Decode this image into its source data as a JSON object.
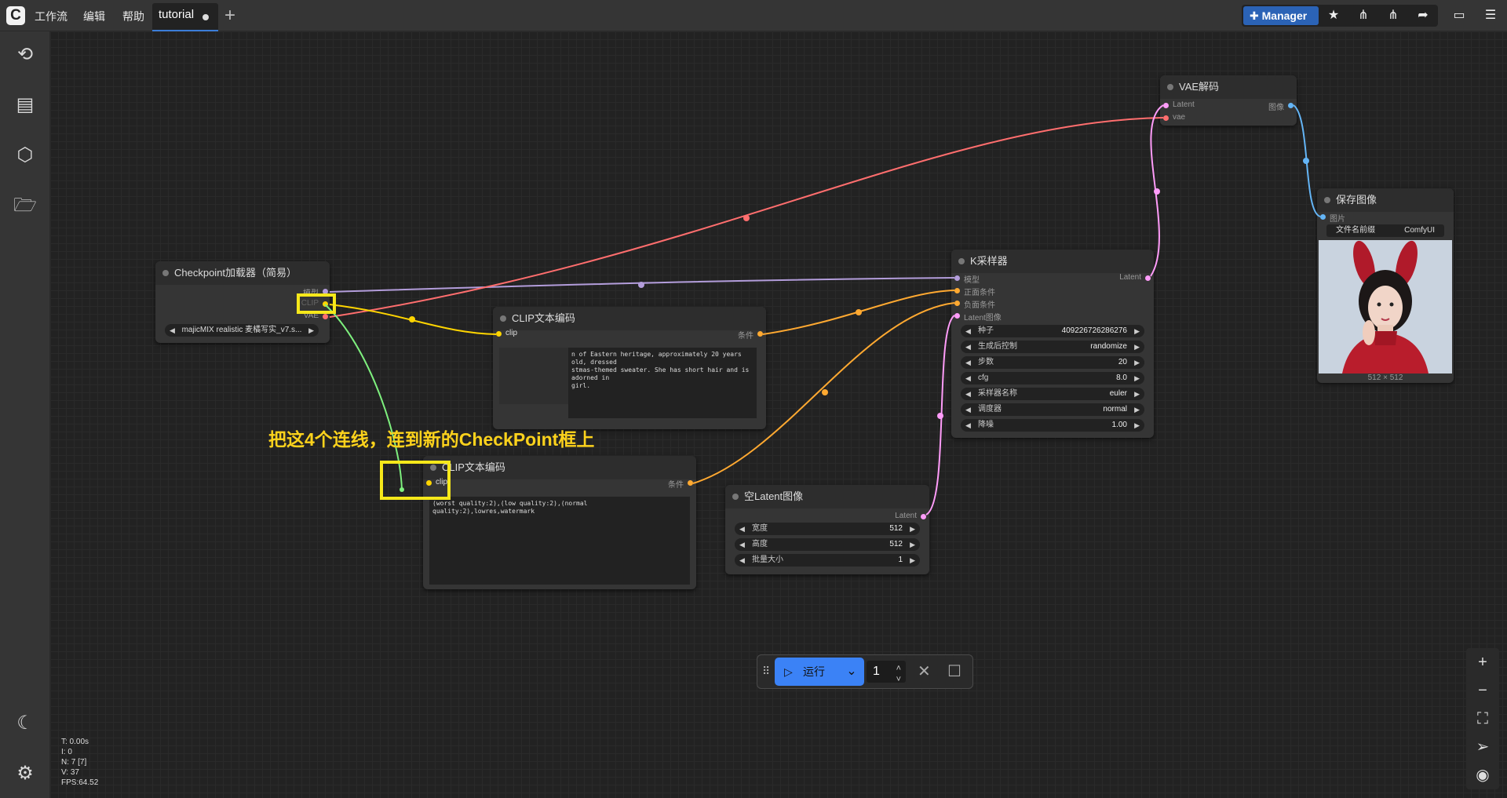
{
  "topbar": {
    "logo": "C",
    "menu": [
      "工作流",
      "编辑",
      "帮助"
    ],
    "tab_title": "tutorial",
    "manager_label": "Manager",
    "icons": [
      "puzzle-icon",
      "star-icon",
      "node-icon",
      "node-alt-icon",
      "share-icon",
      "panel-icon",
      "hamburger-icon"
    ]
  },
  "sidebar": {
    "icons": [
      "history-icon",
      "document-icon",
      "cube-icon",
      "folder-icon",
      "moon-icon",
      "gear-icon"
    ]
  },
  "nodes": {
    "checkpoint": {
      "title": "Checkpoint加载器（简易）",
      "outputs": [
        "模型",
        "CLIP",
        "VAE"
      ],
      "model_value": "majicMIX realistic 麦橘写实_v7.s..."
    },
    "clip1": {
      "title": "CLIP文本编码",
      "input": "clip",
      "output": "条件",
      "text": "n of Eastern heritage, approximately 20 years old, dressed\nstmas-themed sweater. She has short hair and is adorned in\ngirl."
    },
    "clip2": {
      "title": "CLIP文本编码",
      "input": "clip",
      "output": "条件",
      "text": "(worst quality:2),(low quality:2),(normal quality:2),lowres,watermark"
    },
    "ksampler": {
      "title": "K采样器",
      "inputs": [
        "模型",
        "正面条件",
        "负面条件",
        "Latent图像"
      ],
      "output": "Latent",
      "widgets": [
        {
          "label": "种子",
          "value": "409226726286276"
        },
        {
          "label": "生成后控制",
          "value": "randomize"
        },
        {
          "label": "步数",
          "value": "20"
        },
        {
          "label": "cfg",
          "value": "8.0"
        },
        {
          "label": "采样器名称",
          "value": "euler"
        },
        {
          "label": "调度器",
          "value": "normal"
        },
        {
          "label": "降噪",
          "value": "1.00"
        }
      ]
    },
    "latent": {
      "title": "空Latent图像",
      "output": "Latent",
      "widgets": [
        {
          "label": "宽度",
          "value": "512"
        },
        {
          "label": "高度",
          "value": "512"
        },
        {
          "label": "批量大小",
          "value": "1"
        }
      ]
    },
    "vae": {
      "title": "VAE解码",
      "inputs": [
        "Latent",
        "vae"
      ],
      "output": "图像"
    },
    "save": {
      "title": "保存图像",
      "input": "图片",
      "prefix_label": "文件名前缀",
      "prefix_value": "ComfyUI",
      "size": "512 × 512"
    }
  },
  "annotation": "把这4个连线，连到新的CheckPoint框上",
  "runbar": {
    "run_label": "运行",
    "count": "1"
  },
  "stats": [
    "T: 0.00s",
    "I: 0",
    "N: 7 [7]",
    "V: 37",
    "FPS:64.52"
  ],
  "colors": {
    "model_link": "#b39ddb",
    "clip_link": "#ffd500",
    "vae_link": "#ff6e6e",
    "conditioning_link": "#ffa931",
    "latent_link": "#ff9cf9",
    "image_link": "#64b5f6",
    "dragged_link": "#7ef07e",
    "highlight": "#f6e81a"
  }
}
